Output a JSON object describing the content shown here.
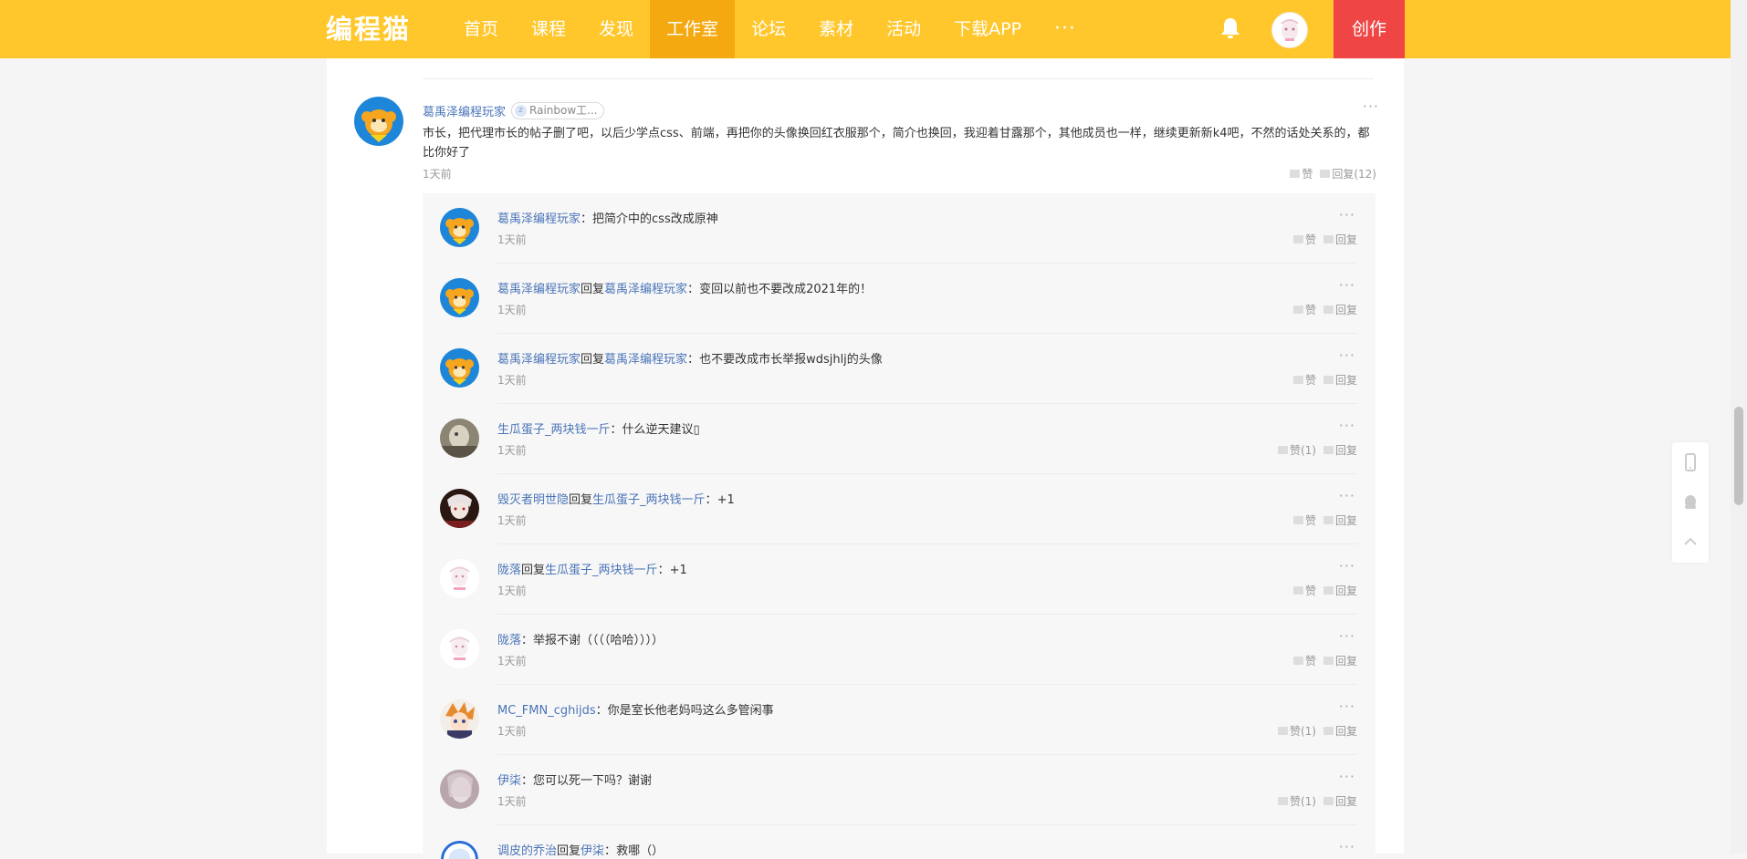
{
  "nav": {
    "logo": "编程猫",
    "items": [
      {
        "label": "首页",
        "active": false
      },
      {
        "label": "课程",
        "active": false
      },
      {
        "label": "发现",
        "active": false
      },
      {
        "label": "工作室",
        "active": true
      },
      {
        "label": "论坛",
        "active": false
      },
      {
        "label": "素材",
        "active": false
      },
      {
        "label": "活动",
        "active": false
      },
      {
        "label": "下载APP",
        "active": false
      }
    ],
    "more_label": "···",
    "create_label": "创作",
    "bell_icon": "bell-icon",
    "colors": {
      "bar": "#ffc72b",
      "active": "#f4a910",
      "create": "#ef4545"
    }
  },
  "main_comment": {
    "user": "葛禹泽编程玩家",
    "badge_text": "Rainbow工...",
    "badge_icon": "z",
    "text": "市长，把代理市长的帖子删了吧，以后少学点css、前端，再把你的头像换回红衣服那个，简介也换回，我迎着甘露那个，其他成员也一样，继续更新新k4吧，不然的话处关系的，都比你好了",
    "time": "1天前",
    "like_label": "赞",
    "reply_label": "回复(12)",
    "more_label": "···"
  },
  "replies": [
    {
      "user": "葛禹泽编程玩家",
      "reply_word": "",
      "target": "",
      "sep": "：",
      "text": "把简介中的css改成原神",
      "time": "1天前",
      "like": "赞",
      "reply": "回复",
      "avatar": "monkey"
    },
    {
      "user": "葛禹泽编程玩家",
      "reply_word": "回复",
      "target": "葛禹泽编程玩家",
      "sep": "：",
      "text": "变回以前也不要改成2021年的！",
      "time": "1天前",
      "like": "赞",
      "reply": "回复",
      "avatar": "monkey"
    },
    {
      "user": "葛禹泽编程玩家",
      "reply_word": "回复",
      "target": "葛禹泽编程玩家",
      "sep": "：",
      "text": "也不要改成市长举报wdsjhlj的头像",
      "time": "1天前",
      "like": "赞",
      "reply": "回复",
      "avatar": "monkey"
    },
    {
      "user": "生瓜蛋子_两块钱一斤",
      "reply_word": "",
      "target": "",
      "sep": "：",
      "text": "什么逆天建议▯",
      "time": "1天前",
      "like": "赞(1)",
      "reply": "回复",
      "avatar": "photo"
    },
    {
      "user": "毁灭者明世隐",
      "reply_word": "回复",
      "target": "生瓜蛋子_两块钱一斤",
      "sep": "：",
      "text": "+1",
      "time": "1天前",
      "like": "赞",
      "reply": "回复",
      "avatar": "dark"
    },
    {
      "user": "陇落",
      "reply_word": "回复",
      "target": "生瓜蛋子_两块钱一斤",
      "sep": "：",
      "text": "+1",
      "time": "1天前",
      "like": "赞",
      "reply": "回复",
      "avatar": "pink"
    },
    {
      "user": "陇落",
      "reply_word": "",
      "target": "",
      "sep": "：",
      "text": "举报不谢（（（（哈哈））））",
      "time": "1天前",
      "like": "赞",
      "reply": "回复",
      "avatar": "pink"
    },
    {
      "user": "MC_FMN_cghijds",
      "reply_word": "",
      "target": "",
      "sep": "：",
      "text": "你是室长他老妈吗这么多管闲事",
      "time": "1天前",
      "like": "赞(1)",
      "reply": "回复",
      "avatar": "anime"
    },
    {
      "user": "伊柒",
      "reply_word": "",
      "target": "",
      "sep": "：",
      "text": "您可以死一下吗？谢谢",
      "time": "1天前",
      "like": "赞(1)",
      "reply": "回复",
      "avatar": "grey"
    },
    {
      "user": "调皮的乔治",
      "reply_word": "回复",
      "target": "伊柒",
      "sep": "：",
      "text": "救哪（）",
      "time": "",
      "like": "",
      "reply": "",
      "avatar": "blue"
    }
  ],
  "side_tools": [
    {
      "icon": "mobile-icon"
    },
    {
      "icon": "qq-icon"
    },
    {
      "icon": "back-to-top-icon"
    }
  ]
}
